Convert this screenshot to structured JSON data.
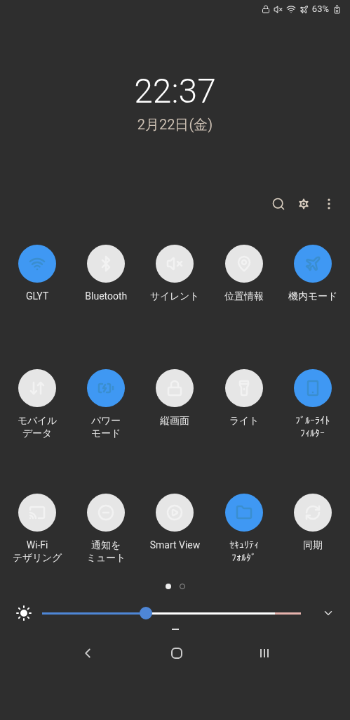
{
  "status_bar": {
    "battery_text": "63%"
  },
  "clock": {
    "time": "22:37",
    "date": "2月22日(金)"
  },
  "tiles": [
    {
      "label_lines": [
        "GLYT"
      ],
      "on": true
    },
    {
      "label_lines": [
        "Bluetooth"
      ],
      "on": false
    },
    {
      "label_lines": [
        "サイレント"
      ],
      "on": false
    },
    {
      "label_lines": [
        "位置情報"
      ],
      "on": false
    },
    {
      "label_lines": [
        "機内モード"
      ],
      "on": true
    },
    {
      "label_lines": [
        "モバイル",
        "データ"
      ],
      "on": false
    },
    {
      "label_lines": [
        "パワー",
        "モード"
      ],
      "on": true
    },
    {
      "label_lines": [
        "縦画面"
      ],
      "on": false
    },
    {
      "label_lines": [
        "ライト"
      ],
      "on": false
    },
    {
      "label_lines": [
        "ﾌﾞﾙｰﾗｲﾄ",
        "ﾌｨﾙﾀｰ"
      ],
      "on": true
    },
    {
      "label_lines": [
        "Wi-Fi",
        "テザリング"
      ],
      "on": false
    },
    {
      "label_lines": [
        "通知を",
        "ミュート"
      ],
      "on": false
    },
    {
      "label_lines": [
        "Smart View"
      ],
      "on": false
    },
    {
      "label_lines": [
        "ｾｷｭﾘﾃｨ",
        "ﾌｫﾙﾀﾞ"
      ],
      "on": true
    },
    {
      "label_lines": [
        "同期"
      ],
      "on": false
    }
  ],
  "pages": [
    {
      "selected": true
    },
    {
      "selected": false
    }
  ],
  "brightness": {
    "level": 0.4
  }
}
